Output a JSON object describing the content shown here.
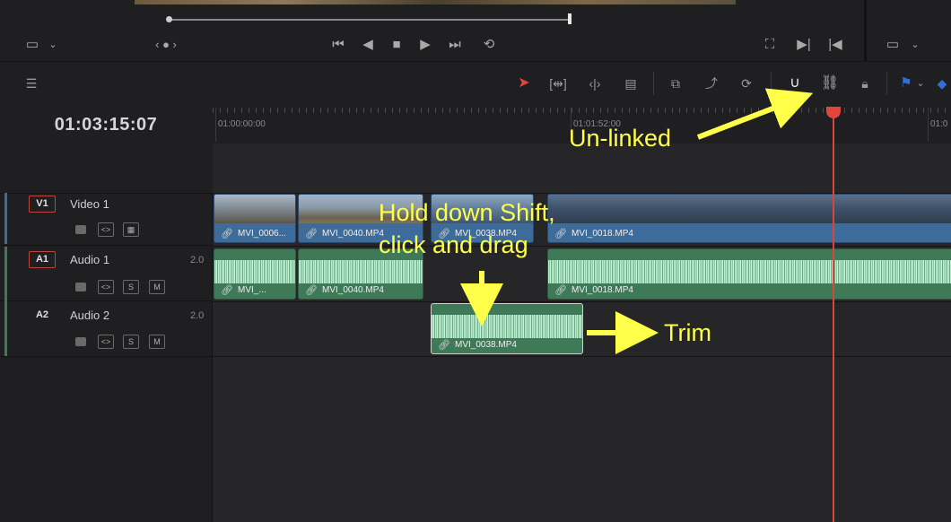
{
  "timecode": "01:03:15:07",
  "ruler": {
    "tc_start": "01:00:00:00",
    "tc_mid": "01:01:52:00",
    "tc_end": "01:0"
  },
  "tracks": [
    {
      "id": "V1",
      "name": "Video 1",
      "kind": "video"
    },
    {
      "id": "A1",
      "name": "Audio 1",
      "volume": "2.0",
      "kind": "audio",
      "solo": "S",
      "mute": "M"
    },
    {
      "id": "A2",
      "name": "Audio 2",
      "volume": "2.0",
      "kind": "audio",
      "solo": "S",
      "mute": "M"
    }
  ],
  "video_clips": [
    "MVI_0006...",
    "MVI_0040.MP4",
    "MVI_0038.MP4",
    "MVI_0018.MP4"
  ],
  "audio1_clips": [
    "MVI_...",
    "MVI_0040.MP4",
    "MVI_0018.MP4"
  ],
  "audio2_clips": [
    "MVI_0038.MP4"
  ],
  "annotations": {
    "unlinked": "Un-linked",
    "shift_line1": "Hold down Shift,",
    "shift_line2": "click and drag",
    "trim": "Trim"
  },
  "colors": {
    "accent_red": "#e0463b",
    "video_clip": "#3d6c9a",
    "audio_clip": "#3f7a58",
    "annotation": "#ffff4a"
  },
  "icons": [
    "viewer-mode-icon",
    "chevron-down-icon",
    "skip-back-icon",
    "play-reverse-icon",
    "stop-icon",
    "play-icon",
    "skip-forward-icon",
    "loop-icon",
    "fullscreen-icon",
    "mark-in-icon",
    "mark-out-icon",
    "timeline-view-icon",
    "select-tool-icon",
    "trim-tool-icon",
    "dynamic-trim-icon",
    "blade-tool-icon",
    "insert-clip-icon",
    "overwrite-clip-icon",
    "replace-clip-icon",
    "snapping-icon",
    "linked-selection-icon",
    "position-lock-icon",
    "flag-icon",
    "marker-icon"
  ]
}
